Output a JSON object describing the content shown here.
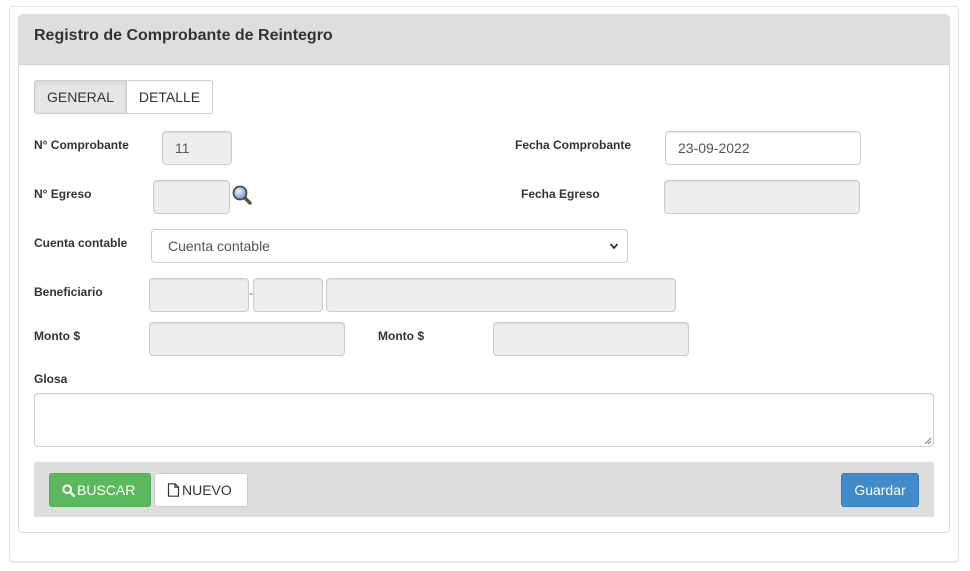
{
  "panel": {
    "title": "Registro de Comprobante de Reintegro"
  },
  "tabs": [
    {
      "label": "GENERAL"
    },
    {
      "label": "DETALLE"
    }
  ],
  "form": {
    "comprobante": {
      "label": "N° Comprobante",
      "value": "11"
    },
    "fecha_comprobante": {
      "label": "Fecha Comprobante",
      "value": "23-09-2022"
    },
    "egreso": {
      "label": "N° Egreso",
      "value": ""
    },
    "fecha_egreso": {
      "label": "Fecha Egreso",
      "value": ""
    },
    "cuenta_contable": {
      "label": "Cuenta contable",
      "selected": "Cuenta contable"
    },
    "beneficiario": {
      "label": "Beneficiario",
      "rut": "",
      "dv": "",
      "nombre": "",
      "separator": "-"
    },
    "monto1": {
      "label": "Monto $",
      "value": ""
    },
    "monto2": {
      "label": "Monto $",
      "value": ""
    },
    "glosa": {
      "label": "Glosa",
      "value": ""
    }
  },
  "actions": {
    "buscar": "BUSCAR",
    "nuevo": "NUEVO",
    "guardar": "Guardar"
  },
  "icons": {
    "search_button": "search-icon",
    "egreso_lookup": "magnifier-icon",
    "nuevo": "file-icon",
    "select": "chevron-down-icon"
  },
  "colors": {
    "success": "#5cb85c",
    "primary": "#428bca",
    "heading_bg": "#dedede",
    "footer_bg": "#dddddd",
    "readonly_bg": "#eeeeee"
  }
}
